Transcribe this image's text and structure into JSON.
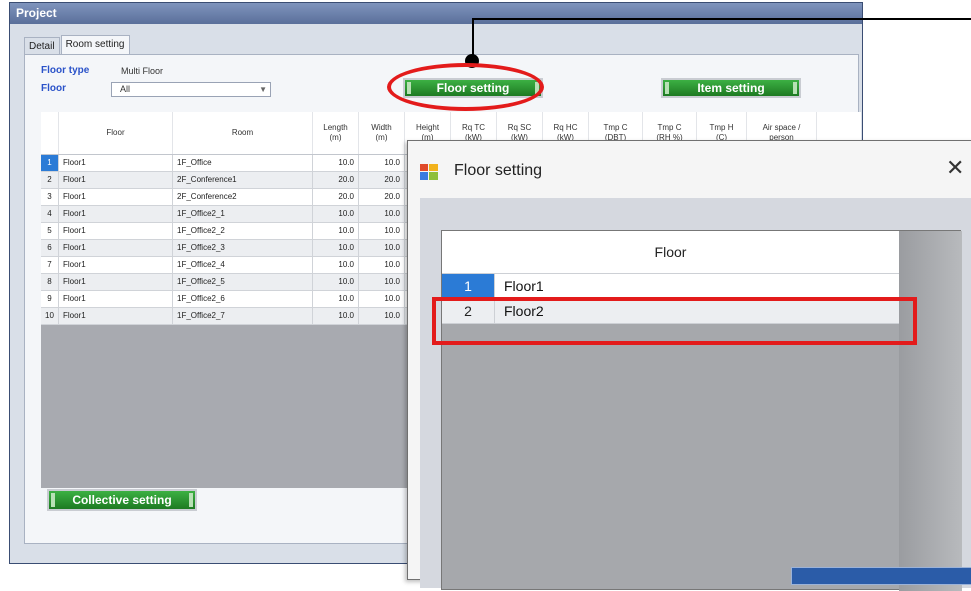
{
  "project": {
    "title": "Project",
    "tabs": [
      "Detail",
      "Room setting"
    ],
    "floor_type_label": "Floor type",
    "floor_type_value": "Multi Floor",
    "floor_label": "Floor",
    "floor_value": "All",
    "floor_setting_btn": "Floor setting",
    "item_setting_btn": "Item setting",
    "collective_setting_btn": "Collective setting",
    "columns": [
      "Floor",
      "Room",
      "Length\n(m)",
      "Width\n(m)",
      "Height\n(m)",
      "Rq TC\n(kW)",
      "Rq SC\n(kW)",
      "Rq HC\n(kW)",
      "Tmp C\n(DBT)",
      "Tmp C\n(RH %)",
      "Tmp H\n(C)",
      "Air space /\nperson"
    ],
    "rows": [
      {
        "idx": "1",
        "floor": "Floor1",
        "room": "1F_Office",
        "length": "10.0",
        "width": "10.0"
      },
      {
        "idx": "2",
        "floor": "Floor1",
        "room": "2F_Conference1",
        "length": "20.0",
        "width": "20.0"
      },
      {
        "idx": "3",
        "floor": "Floor1",
        "room": "2F_Conference2",
        "length": "20.0",
        "width": "20.0"
      },
      {
        "idx": "4",
        "floor": "Floor1",
        "room": "1F_Office2_1",
        "length": "10.0",
        "width": "10.0"
      },
      {
        "idx": "5",
        "floor": "Floor1",
        "room": "1F_Office2_2",
        "length": "10.0",
        "width": "10.0"
      },
      {
        "idx": "6",
        "floor": "Floor1",
        "room": "1F_Office2_3",
        "length": "10.0",
        "width": "10.0"
      },
      {
        "idx": "7",
        "floor": "Floor1",
        "room": "1F_Office2_4",
        "length": "10.0",
        "width": "10.0"
      },
      {
        "idx": "8",
        "floor": "Floor1",
        "room": "1F_Office2_5",
        "length": "10.0",
        "width": "10.0"
      },
      {
        "idx": "9",
        "floor": "Floor1",
        "room": "1F_Office2_6",
        "length": "10.0",
        "width": "10.0"
      },
      {
        "idx": "10",
        "floor": "Floor1",
        "room": "1F_Office2_7",
        "length": "10.0",
        "width": "10.0"
      }
    ]
  },
  "dialog": {
    "title": "Floor setting",
    "close_glyph": "✕",
    "column": "Floor",
    "rows": [
      {
        "idx": "1",
        "name": "Floor1"
      },
      {
        "idx": "2",
        "name": "Floor2"
      }
    ]
  },
  "colors": {
    "highlight_red": "#e31b1b",
    "selection_blue": "#2b7bd6",
    "button_green": "#2a8f30"
  }
}
